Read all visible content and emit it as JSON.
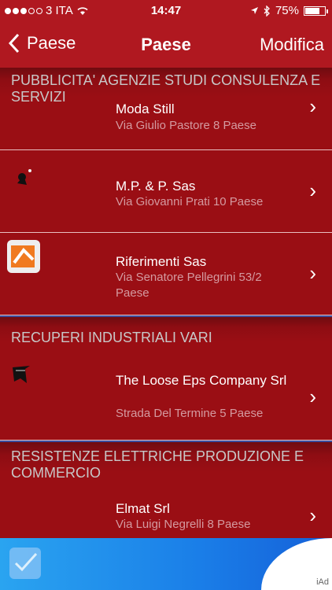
{
  "status": {
    "carrier": "3 ITA",
    "time": "14:47",
    "battery": "75%",
    "battery_level": 0.75
  },
  "nav": {
    "back_label": "Paese",
    "title": "Paese",
    "edit_label": "Modifica"
  },
  "sections": [
    {
      "header": "PUBBLICITA' AGENZIE STUDI CONSULENZA E SERVIZI",
      "rows": [
        {
          "name": "Moda Still",
          "address": "Via Giulio Pastore 8 Paese"
        },
        {
          "name": "M.P. & P. Sas",
          "address": "Via Giovanni Prati 10 Paese"
        },
        {
          "name": "Riferimenti Sas",
          "address": "Via Senatore Pellegrini 53/2 Paese"
        }
      ]
    },
    {
      "header": "RECUPERI INDUSTRIALI VARI",
      "rows": [
        {
          "name": "The Loose Eps Company Srl",
          "address": "Strada Del Termine 5 Paese"
        }
      ]
    },
    {
      "header": "RESISTENZE ELETTRICHE PRODUZIONE E COMMERCIO",
      "rows": [
        {
          "name": "Elmat Srl",
          "address": "Via Luigi Negrelli 8 Paese"
        }
      ]
    }
  ],
  "ad": {
    "label": "iAd"
  },
  "colors": {
    "background": "#9a0e14",
    "bar": "#b01820",
    "ad_blue": "#1a7ee8"
  }
}
